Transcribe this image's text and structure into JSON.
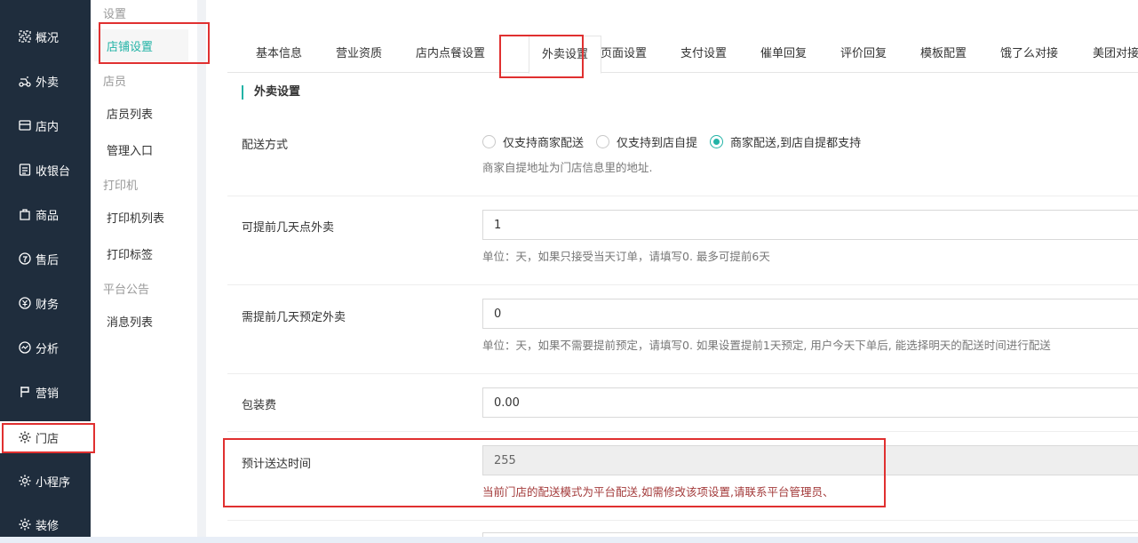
{
  "sidebar": {
    "items": [
      {
        "label": "概况",
        "icon": "overview-icon",
        "active": false
      },
      {
        "label": "外卖",
        "icon": "delivery-icon",
        "active": false
      },
      {
        "label": "店内",
        "icon": "dine-in-icon",
        "active": false
      },
      {
        "label": "收银台",
        "icon": "cashier-icon",
        "active": false
      },
      {
        "label": "商品",
        "icon": "goods-icon",
        "active": false
      },
      {
        "label": "售后",
        "icon": "after-sales-icon",
        "active": false
      },
      {
        "label": "财务",
        "icon": "finance-icon",
        "active": false
      },
      {
        "label": "分析",
        "icon": "analysis-icon",
        "active": false
      },
      {
        "label": "营销",
        "icon": "marketing-icon",
        "active": false
      },
      {
        "label": "门店",
        "icon": "gear-icon",
        "active": true
      },
      {
        "label": "小程序",
        "icon": "gear-icon",
        "active": false
      },
      {
        "label": "装修",
        "icon": "gear-icon",
        "active": false
      }
    ]
  },
  "subnav": {
    "group_settings": "设置",
    "store_settings": "店铺设置",
    "group_staff": "店员",
    "staff_list": "店员列表",
    "manage_entry": "管理入口",
    "group_printer": "打印机",
    "printer_list": "打印机列表",
    "print_label": "打印标签",
    "group_notice": "平台公告",
    "message_list": "消息列表"
  },
  "tabs": [
    {
      "label": "基本信息"
    },
    {
      "label": "营业资质"
    },
    {
      "label": "店内点餐设置"
    },
    {
      "label": "外卖设置"
    },
    {
      "label": "页面设置"
    },
    {
      "label": "支付设置"
    },
    {
      "label": "催单回复"
    },
    {
      "label": "评价回复"
    },
    {
      "label": "模板配置"
    },
    {
      "label": "饿了么对接"
    },
    {
      "label": "美团对接"
    }
  ],
  "section_title": "外卖设置",
  "form": {
    "delivery_mode": {
      "label": "配送方式",
      "options": [
        "仅支持商家配送",
        "仅支持到店自提",
        "商家配送,到店自提都支持"
      ],
      "selected": "商家配送,到店自提都支持",
      "help": "商家自提地址为门店信息里的地址."
    },
    "advance_days": {
      "label": "可提前几天点外卖",
      "value": "1",
      "help": "单位：天，如果只接受当天订单，请填写0. 最多可提前6天"
    },
    "preorder_days": {
      "label": "需提前几天预定外卖",
      "value": "0",
      "help": "单位：天，如果不需要提前预定，请填写0. 如果设置提前1天预定, 用户今天下单后, 能选择明天的配送时间进行配送"
    },
    "packing_fee": {
      "label": "包装费",
      "value": "0.00"
    },
    "estimated_time": {
      "label": "预计送达时间",
      "value": "255",
      "help": "当前门店的配送模式为平台配送,如需修改该项设置,请联系平台管理员、"
    }
  },
  "colors": {
    "accent": "#22b3a6",
    "sidebar_bg": "#1f2d3d",
    "highlight": "#e03030",
    "warn_text": "#a33a3a"
  }
}
